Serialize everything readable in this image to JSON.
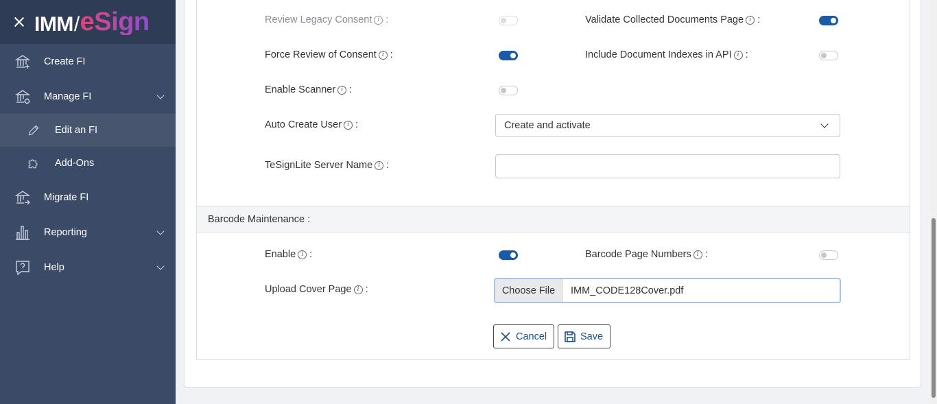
{
  "sidebar": {
    "logo": {
      "imm": "IMM",
      "slash": "/",
      "esign": "eSign"
    },
    "items": [
      {
        "label": "Create FI",
        "icon": "bank-plus-icon"
      },
      {
        "label": "Manage FI",
        "icon": "bank-gear-icon"
      },
      {
        "label": "Edit an FI",
        "icon": "pencil-icon"
      },
      {
        "label": "Add-Ons",
        "icon": "puzzle-icon"
      },
      {
        "label": "Migrate FI",
        "icon": "bank-arrow-icon"
      },
      {
        "label": "Reporting",
        "icon": "bar-chart-icon"
      },
      {
        "label": "Help",
        "icon": "question-bubble-icon"
      }
    ]
  },
  "form": {
    "review_legacy_consent": {
      "label": "Review Legacy Consent",
      "suffix": ":",
      "enabled": false,
      "disabled": true
    },
    "validate_collected_docs": {
      "label": "Validate Collected Documents Page",
      "suffix": ":",
      "enabled": true
    },
    "force_review_consent": {
      "label": "Force Review of Consent",
      "suffix": ":",
      "enabled": true
    },
    "include_doc_indexes": {
      "label": "Include Document Indexes in API",
      "suffix": ":",
      "enabled": false
    },
    "enable_scanner": {
      "label": "Enable Scanner",
      "suffix": ":",
      "enabled": false
    },
    "auto_create_user": {
      "label": "Auto Create User",
      "suffix": ":",
      "value": "Create and activate"
    },
    "tesignlite_server": {
      "label": "TeSignLite Server Name",
      "suffix": ":",
      "value": ""
    }
  },
  "barcode": {
    "section_title": "Barcode Maintenance :",
    "enable": {
      "label": "Enable",
      "suffix": ":",
      "enabled": true
    },
    "page_numbers": {
      "label": "Barcode Page Numbers",
      "suffix": ":",
      "enabled": false
    },
    "cover_page": {
      "label": "Upload Cover Page",
      "suffix": ":",
      "button": "Choose File",
      "filename": "IMM_CODE128Cover.pdf"
    }
  },
  "actions": {
    "cancel": "Cancel",
    "save": "Save"
  },
  "info_glyph": "i",
  "colors": {
    "sidebar": "#3b4a66",
    "accent": "#1b5aa6"
  }
}
